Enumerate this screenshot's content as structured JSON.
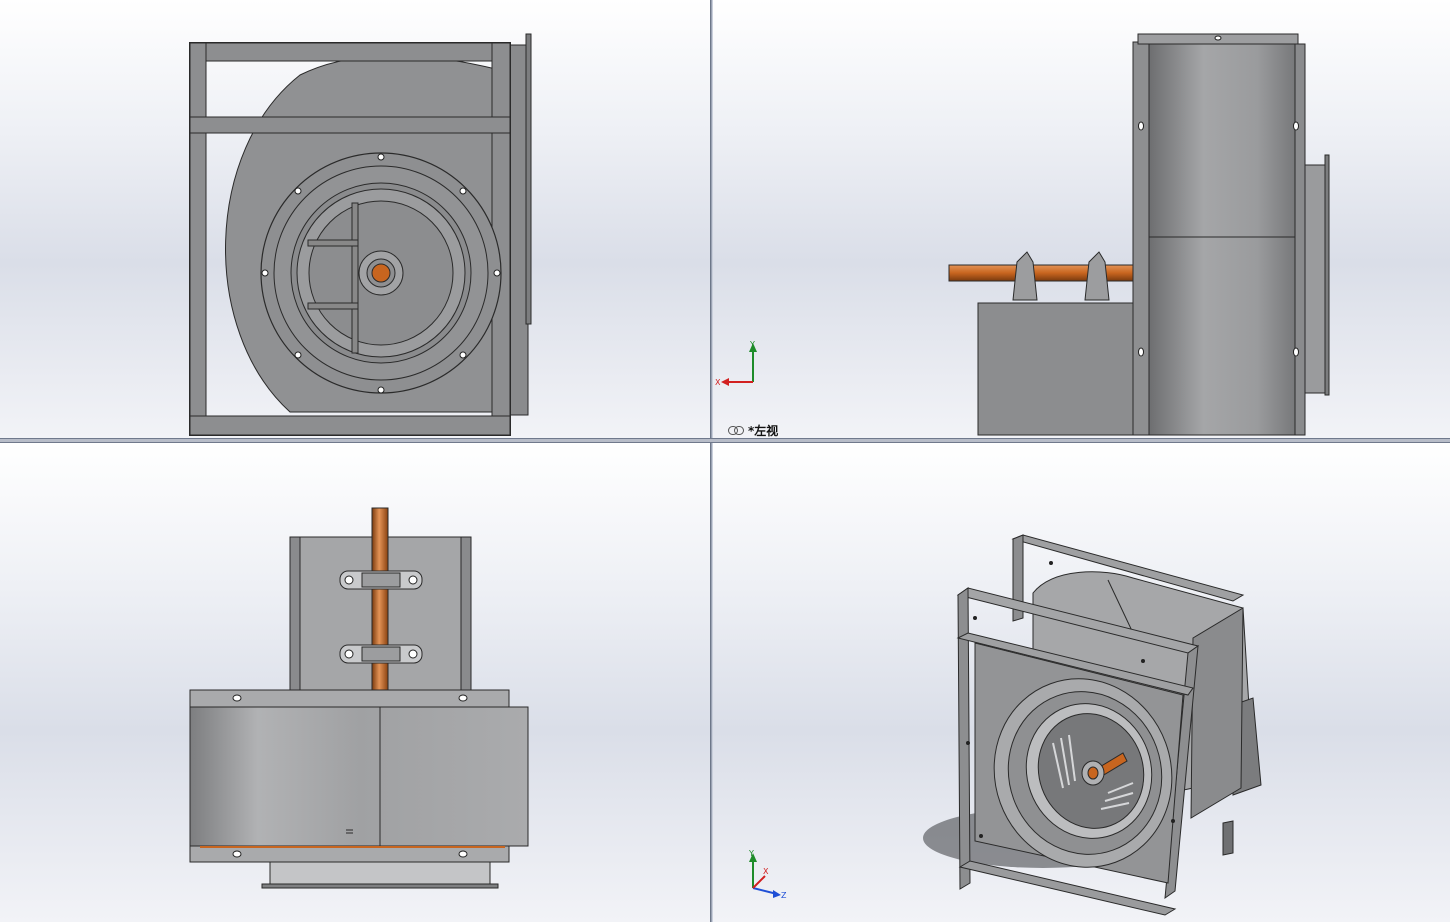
{
  "viewports": {
    "top_left": {
      "name": "front-view"
    },
    "top_right": {
      "name": "left-view",
      "label": "*左视"
    },
    "bottom_left": {
      "name": "top-view"
    },
    "bottom_right": {
      "name": "isometric-view"
    }
  },
  "triad": {
    "top_right": {
      "x": "X",
      "y": "Y"
    },
    "bottom_right": {
      "x": "X",
      "y": "Y",
      "z": "Z"
    }
  },
  "icons": {
    "view_link": "chain-link-icon"
  },
  "colors": {
    "steel": "#8f9092",
    "steel_dark": "#6d6e70",
    "shaft": "#c8651f",
    "edge": "#2a2a2a",
    "axis_x": "#d22020",
    "axis_y": "#1e8c2a",
    "axis_z": "#1f4fd6"
  }
}
